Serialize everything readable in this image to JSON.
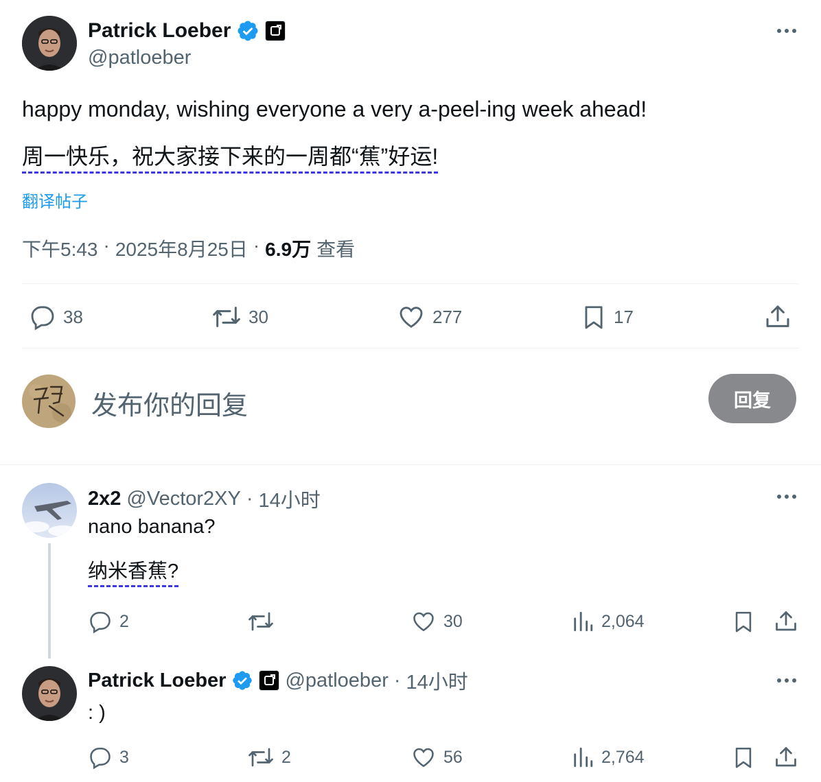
{
  "main_post": {
    "author_name": "Patrick Loeber",
    "author_handle": "@patloeber",
    "text": "happy monday, wishing everyone a very a-peel-ing week ahead!",
    "translated_text": "周一快乐，祝大家接下来的一周都“蕉”好运!",
    "translate_link": "翻译帖子",
    "time": "下午5:43",
    "date": "2025年8月25日",
    "views_count": "6.9万",
    "views_label": "查看",
    "separator": "·",
    "stats": {
      "replies": "38",
      "reposts": "30",
      "likes": "277",
      "bookmarks": "17"
    }
  },
  "reply_composer": {
    "placeholder": "发布你的回复",
    "button_label": "回复"
  },
  "replies": [
    {
      "author_name": "2x2",
      "author_handle": "@Vector2XY",
      "time": "14小时",
      "text": "nano banana?",
      "translated_text": "纳米香蕉?",
      "stats": {
        "replies": "2",
        "reposts": "",
        "likes": "30",
        "views": "2,064"
      }
    },
    {
      "author_name": "Patrick Loeber",
      "author_handle": "@patloeber",
      "time": "14小时",
      "text": ": )",
      "stats": {
        "replies": "3",
        "reposts": "2",
        "likes": "56",
        "views": "2,764"
      }
    }
  ],
  "colors": {
    "text": "#0f1419",
    "muted": "#536471",
    "link": "#1d9bf0",
    "verified": "#1d9bf0",
    "reply_button": "#87898c",
    "translation_underline": "#3b36e6"
  },
  "icons": [
    "verified-badge-icon",
    "affiliate-badge-icon",
    "more-icon",
    "reply-icon",
    "repost-icon",
    "like-icon",
    "bookmark-icon",
    "share-icon",
    "views-icon"
  ]
}
